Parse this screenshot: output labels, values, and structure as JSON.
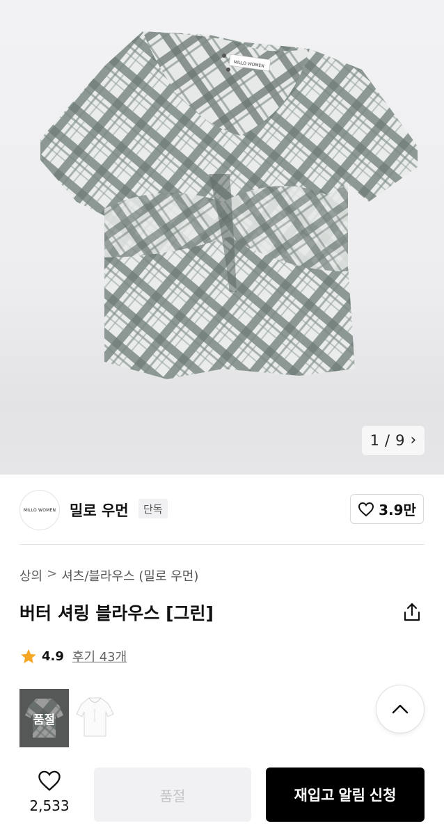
{
  "gallery": {
    "current": "1",
    "total": "9",
    "separator": "/",
    "next_icon": "chevron-right-icon",
    "shirt_tag_text": "MILLO WOMEN"
  },
  "brand": {
    "logo_text": "MILLO WOMEN",
    "name": "밀로 우먼",
    "badge": "단독",
    "like_count": "3.9만",
    "like_icon": "heart-outline-icon"
  },
  "breadcrumb": {
    "category": "상의",
    "separator": ">",
    "subcategory": "셔츠/블라우스 (밀로 우먼)"
  },
  "product": {
    "title": "버터 셔링 블라우스 [그린]",
    "share_icon": "share-icon",
    "rating": "4.9",
    "reviews": "후기 43개",
    "rating_color": "#f5a623"
  },
  "variants": [
    {
      "label": "품절",
      "color": "green plaid",
      "sold_out": true
    },
    {
      "label": "",
      "color": "white",
      "sold_out": false
    }
  ],
  "bottom": {
    "wish_count": "2,533",
    "soldout_label": "품절",
    "restock_label": "재입고 알림 신청"
  }
}
